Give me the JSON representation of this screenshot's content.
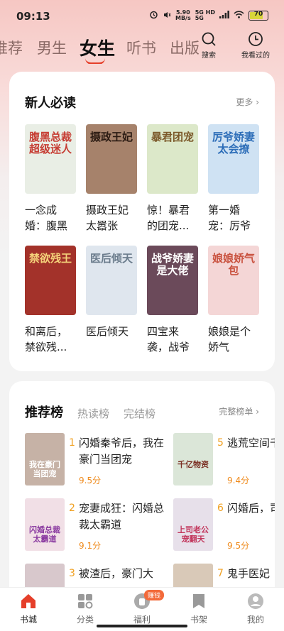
{
  "status": {
    "time": "09:13",
    "speed_top": "5.90",
    "speed_bottom": "MB/s",
    "net_top": "5G HD",
    "net_bottom": "5G",
    "battery": "70"
  },
  "tabs": [
    "推荐",
    "男生",
    "女生",
    "听书",
    "出版"
  ],
  "actions": {
    "search": "搜索",
    "history": "我看过的"
  },
  "new_section": {
    "title": "新人必读",
    "more": "更多",
    "books": [
      {
        "title": "一念成婚：腹黑总...",
        "cover_text": "腹黑总裁超级迷人",
        "bg": "#e9eee5",
        "fg": "#c63d33"
      },
      {
        "title": "摄政王妃太嚣张",
        "cover_text": "摄政王妃",
        "bg": "#a6826b",
        "fg": "#2a1a12"
      },
      {
        "title": "惊！暴君的团宠...",
        "cover_text": "暴君团宠",
        "bg": "#dce8c9",
        "fg": "#7c5a2b"
      },
      {
        "title": "第一婚宠：厉爷娇...",
        "cover_text": "厉爷娇妻太会撩",
        "bg": "#cfe2f3",
        "fg": "#2c6db8"
      },
      {
        "title": "和离后，禁欲残...",
        "cover_text": "禁欲残王",
        "bg": "#a3322a",
        "fg": "#f4d27a"
      },
      {
        "title": "医后倾天",
        "cover_text": "医后倾天",
        "bg": "#dfe6ee",
        "fg": "#6b7c8c"
      },
      {
        "title": "四宝来袭，战爷娇...",
        "cover_text": "战爷娇妻是大佬",
        "bg": "#6b4a5a",
        "fg": "#ffffff"
      },
      {
        "title": "娘娘是个娇气包，...",
        "cover_text": "娘娘娇气包",
        "bg": "#f4d6d6",
        "fg": "#c9523f"
      }
    ]
  },
  "rank_section": {
    "tabs": [
      "推荐榜",
      "热读榜",
      "完结榜"
    ],
    "full": "完整榜单",
    "items": [
      {
        "num": "1",
        "title": "闪婚秦爷后，我在豪门当团宠",
        "score": "9.5分",
        "cover_text": "我在豪门当团宠",
        "bg": "#c6b2a6",
        "fg": "#ffffff"
      },
      {
        "num": "5",
        "title": "逃荒空间千亿物资",
        "score": "9.4分",
        "cover_text": "千亿物资",
        "bg": "#dbe6d8",
        "fg": "#7a2e22"
      },
      {
        "num": "2",
        "title": "宠妻成狂：闪婚总裁太霸道",
        "score": "9.1分",
        "cover_text": "闪婚总裁太霸道",
        "bg": "#f1dfe6",
        "fg": "#8a3aa0"
      },
      {
        "num": "6",
        "title": "闪婚后，司老公宠",
        "score": "9.5分",
        "cover_text": "上司老公宠翻天",
        "bg": "#e7e0ea",
        "fg": "#c2365c"
      },
      {
        "num": "3",
        "title": "被渣后，豪门大",
        "score": "",
        "cover_text": "",
        "bg": "#d8c8cc",
        "fg": "#ffffff"
      },
      {
        "num": "7",
        "title": "鬼手医妃",
        "score": "",
        "cover_text": "",
        "bg": "#d9c9b8",
        "fg": "#ffffff"
      }
    ]
  },
  "nav": {
    "items": [
      "书城",
      "分类",
      "福利",
      "书架",
      "我的"
    ],
    "badge": "赚钱"
  },
  "colors": {
    "accent": "#e53f2a",
    "score": "#ef8a1b"
  }
}
